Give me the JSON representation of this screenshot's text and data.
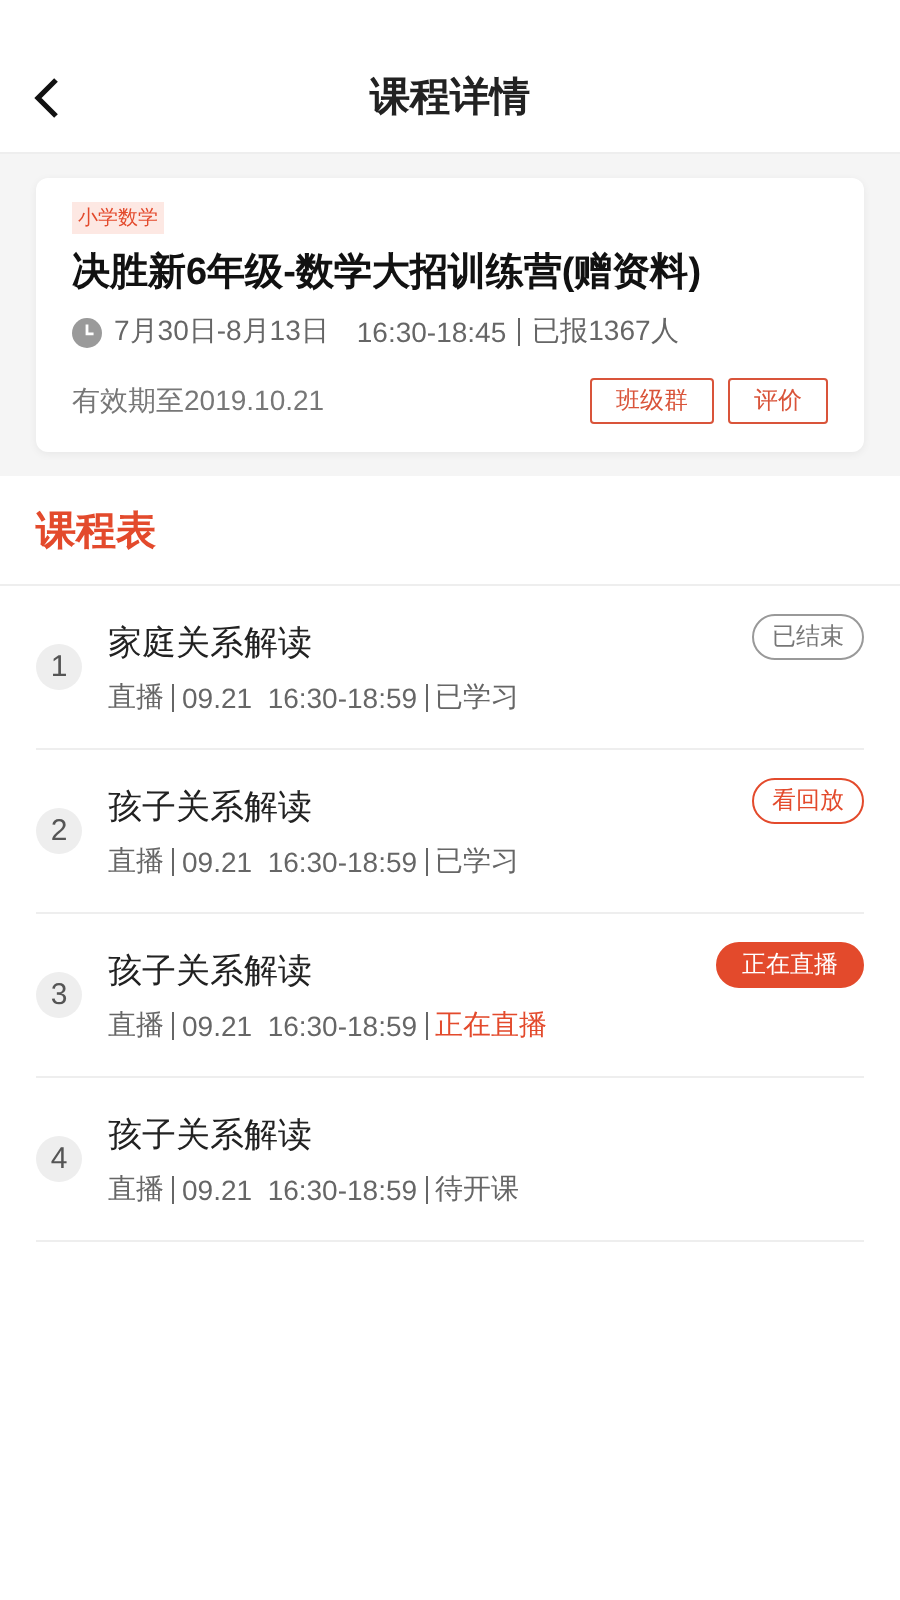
{
  "nav": {
    "title": "课程详情"
  },
  "course": {
    "tag": "小学数学",
    "title": "决胜新6年级-数学大招训练营(赠资料)",
    "dates": "7月30日-8月13日",
    "time": "16:30-18:45",
    "enrolled": "已报1367人",
    "valid": "有效期至2019.10.21",
    "buttons": [
      "班级群",
      "评价"
    ]
  },
  "schedule": {
    "heading": "课程表",
    "lessons": [
      {
        "number": "1",
        "title": "家庭关系解读",
        "type": "直播",
        "time": "09.21  16:30-18:59",
        "status": "已学习",
        "live": false,
        "badge": {
          "kind": "ended",
          "label": "已结束"
        }
      },
      {
        "number": "2",
        "title": "孩子关系解读",
        "type": "直播",
        "time": "09.21  16:30-18:59",
        "status": "已学习",
        "live": false,
        "badge": {
          "kind": "replay",
          "label": "看回放"
        }
      },
      {
        "number": "3",
        "title": "孩子关系解读",
        "type": "直播",
        "time": "09.21  16:30-18:59",
        "status": "正在直播",
        "live": true,
        "badge": {
          "kind": "live",
          "label": "正在直播"
        }
      },
      {
        "number": "4",
        "title": "孩子关系解读",
        "type": "直播",
        "time": "09.21  16:30-18:59",
        "status": "待开课",
        "live": false
      }
    ]
  }
}
